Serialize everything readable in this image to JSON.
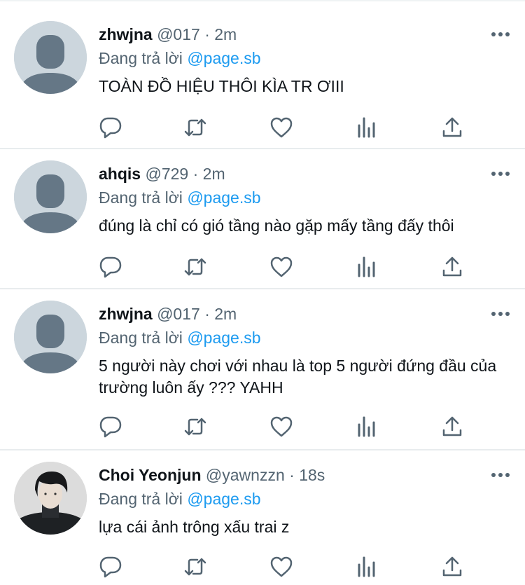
{
  "tweets": [
    {
      "name": "zhwjna",
      "handle": "@017",
      "sep": "·",
      "time": "2m",
      "reply_prefix": "Đang trả lời",
      "reply_to": "@page.sb",
      "text": "TOÀN ĐỒ HIỆU THÔI KÌA TR ƠIII",
      "avatar": "default"
    },
    {
      "name": "ahqis",
      "handle": "@729",
      "sep": "·",
      "time": "2m",
      "reply_prefix": "Đang trả lời",
      "reply_to": "@page.sb",
      "text": "đúng là chỉ có gió tầng nào gặp mấy tầng đấy thôi",
      "avatar": "default"
    },
    {
      "name": "zhwjna",
      "handle": "@017",
      "sep": "·",
      "time": "2m",
      "reply_prefix": "Đang trả lời",
      "reply_to": "@page.sb",
      "text": "5 người này chơi với nhau là top 5 người đứng đầu của trường luôn ấy ??? YAHH",
      "avatar": "default"
    },
    {
      "name": "Choi Yeonjun",
      "handle": "@yawnzzn",
      "sep": "·",
      "time": "18s",
      "reply_prefix": "Đang trả lời",
      "reply_to": "@page.sb",
      "text": "lựa cái ảnh trông xấu trai z",
      "avatar": "photo"
    }
  ],
  "icons": {
    "reply": "reply-icon",
    "retweet": "retweet-icon",
    "like": "like-icon",
    "analytics": "analytics-icon",
    "share": "share-icon",
    "more": "more-icon"
  },
  "colors": {
    "link": "#1d9bf0",
    "secondary": "#536471",
    "icon": "#536471",
    "avatar_bg": "#ccd6dd",
    "avatar_person": "#657786"
  }
}
